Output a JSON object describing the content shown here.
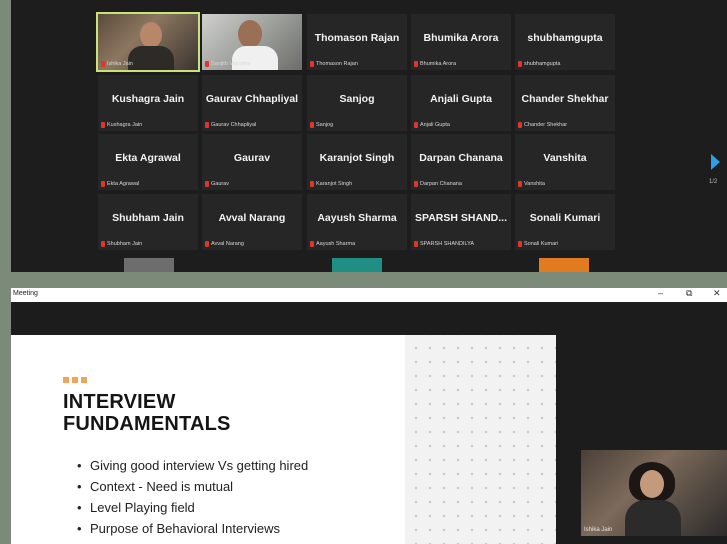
{
  "gallery": {
    "tiles": [
      {
        "display": "",
        "label": "Ishika Jain",
        "video": true
      },
      {
        "display": "",
        "label": "Sanjith Vasudev",
        "video": true
      },
      {
        "display": "Thomason Rajan",
        "label": "Thomason Rajan"
      },
      {
        "display": "Bhumika Arora",
        "label": "Bhumika Arora"
      },
      {
        "display": "shubhamgupta",
        "label": "shubhamgupta"
      },
      {
        "display": "Kushagra Jain",
        "label": "Kushagra Jain"
      },
      {
        "display": "Gaurav Chhapliyal",
        "label": "Gaurav Chhapliyal"
      },
      {
        "display": "Sanjog",
        "label": "Sanjog"
      },
      {
        "display": "Anjali Gupta",
        "label": "Anjali Gupta"
      },
      {
        "display": "Chander Shekhar",
        "label": "Chander Shekhar"
      },
      {
        "display": "Ekta Agrawal",
        "label": "Ekta Agrawal"
      },
      {
        "display": "Gaurav",
        "label": "Gaurav"
      },
      {
        "display": "Karanjot Singh",
        "label": "Karanjot Singh"
      },
      {
        "display": "Darpan Chanana",
        "label": "Darpan Chanana"
      },
      {
        "display": "Vanshita",
        "label": "Vanshita"
      },
      {
        "display": "Shubham Jain",
        "label": "Shubham Jain"
      },
      {
        "display": "Avval Narang",
        "label": "Avval Narang"
      },
      {
        "display": "Aayush Sharma",
        "label": "Aayush Sharma"
      },
      {
        "display": "SPARSH  SHAND...",
        "label": "SPARSH SHANDILYA"
      },
      {
        "display": "Sonali Kumari",
        "label": "Sonali Kumari"
      }
    ],
    "page_indicator": "1/2",
    "accent_color": "#2aa0e6",
    "active_speaker_color": "#c7e37a",
    "muted_icon_color": "#e0352b"
  },
  "meeting_window": {
    "title": "Meeting",
    "controls": {
      "minimize": "–",
      "maximize": "⧉",
      "close": "✕"
    }
  },
  "slide": {
    "title_line1": "INTERVIEW",
    "title_line2": "FUNDAMENTALS",
    "bullets": [
      "Giving good interview Vs getting hired",
      "Context - Need is mutual",
      "Level Playing field",
      "Purpose of Behavioral Interviews"
    ],
    "accent_color": "#f1a35c"
  },
  "self_view": {
    "label": "Ishika Jain"
  }
}
